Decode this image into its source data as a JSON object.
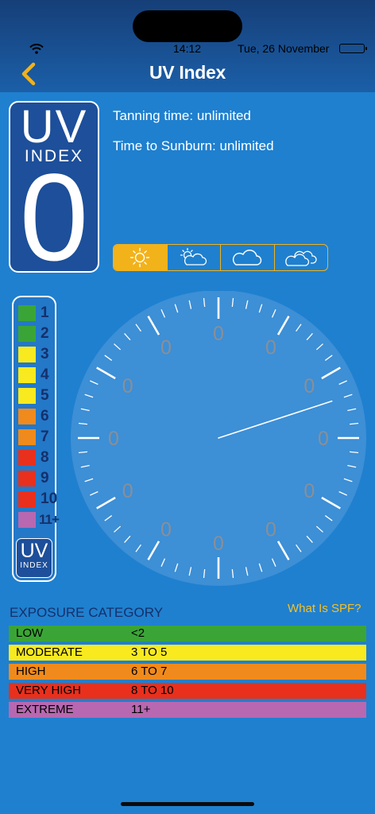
{
  "status_bar": {
    "time": "14:12",
    "date": "Tue, 26 November"
  },
  "nav": {
    "title": "UV Index",
    "back_icon": "chevron-left-icon"
  },
  "uv_badge": {
    "label_top": "UV",
    "label_bottom": "INDEX",
    "value": "0"
  },
  "info": {
    "tanning": "Tanning time: unlimited",
    "sunburn": "Time to Sunburn: unlimited"
  },
  "weather_options": [
    {
      "icon": "sun-icon",
      "selected": true
    },
    {
      "icon": "sun-cloud-icon",
      "selected": false
    },
    {
      "icon": "cloud-icon",
      "selected": false
    },
    {
      "icon": "clouds-icon",
      "selected": false
    }
  ],
  "legend": {
    "items": [
      {
        "label": "1",
        "color": "#3aa536"
      },
      {
        "label": "2",
        "color": "#3aa536"
      },
      {
        "label": "3",
        "color": "#f8ea1e"
      },
      {
        "label": "4",
        "color": "#f8ea1e"
      },
      {
        "label": "5",
        "color": "#f8ea1e"
      },
      {
        "label": "6",
        "color": "#f08a1c"
      },
      {
        "label": "7",
        "color": "#f08a1c"
      },
      {
        "label": "8",
        "color": "#e8301d"
      },
      {
        "label": "9",
        "color": "#e8301d"
      },
      {
        "label": "10",
        "color": "#e8301d"
      },
      {
        "label": "11+",
        "color": "#b768b0"
      }
    ],
    "logo_top": "UV",
    "logo_bottom": "INDEX"
  },
  "dial": {
    "labels": [
      "0",
      "0",
      "0",
      "0",
      "0",
      "0",
      "0",
      "0",
      "0",
      "0",
      "0",
      "0"
    ],
    "needle_hour_position": 2.4
  },
  "exposure": {
    "title": "EXPOSURE CATEGORY",
    "spf_link": "What Is SPF?",
    "rows": [
      {
        "name": "LOW",
        "range": "<2",
        "color": "#3aa536"
      },
      {
        "name": "MODERATE",
        "range": "3 TO 5",
        "color": "#f8ea1e"
      },
      {
        "name": "HIGH",
        "range": "6 TO 7",
        "color": "#f08a1c"
      },
      {
        "name": "VERY HIGH",
        "range": "8 TO 10",
        "color": "#e8301d"
      },
      {
        "name": "EXTREME",
        "range": "11+",
        "color": "#b768b0"
      }
    ]
  }
}
